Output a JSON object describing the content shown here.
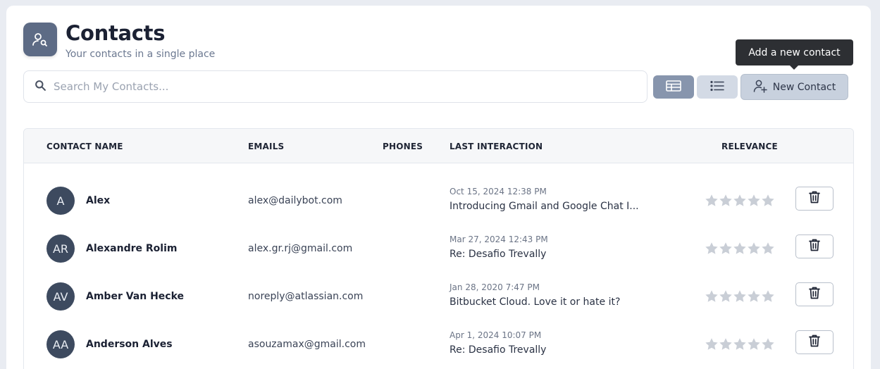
{
  "header": {
    "icon": "contact-search-icon",
    "title": "Contacts",
    "subtitle": "Your contacts in a single place"
  },
  "search": {
    "placeholder": "Search My Contacts...",
    "value": "",
    "icon": "search-icon"
  },
  "toolbar": {
    "table_view_icon": "table-view-icon",
    "list_view_icon": "list-view-icon",
    "new_contact_label": "New Contact",
    "new_contact_icon": "add-user-icon",
    "tooltip": "Add a new contact"
  },
  "table": {
    "columns": [
      "CONTACT NAME",
      "EMAILS",
      "PHONES",
      "LAST INTERACTION",
      "RELEVANCE"
    ],
    "rows": [
      {
        "initials": "A",
        "name": "Alex",
        "email": "alex@dailybot.com",
        "phone": "",
        "date": "Oct 15, 2024 12:38 PM",
        "subject": "Introducing Gmail and Google Chat I...",
        "relevance": 0
      },
      {
        "initials": "AR",
        "name": "Alexandre Rolim",
        "email": "alex.gr.rj@gmail.com",
        "phone": "",
        "date": "Mar 27, 2024 12:43 PM",
        "subject": "Re: Desafio Trevally",
        "relevance": 0
      },
      {
        "initials": "AV",
        "name": "Amber Van Hecke",
        "email": "noreply@atlassian.com",
        "phone": "",
        "date": "Jan 28, 2020 7:47 PM",
        "subject": "Bitbucket Cloud. Love it or hate it?",
        "relevance": 0
      },
      {
        "initials": "AA",
        "name": "Anderson Alves",
        "email": "asouzamax@gmail.com",
        "phone": "",
        "date": "Apr 1, 2024 10:07 PM",
        "subject": "Re: Desafio Trevally",
        "relevance": 0
      }
    ]
  },
  "colors": {
    "accent": "#5d6b85",
    "avatar": "#3d4a5f",
    "star_empty": "#c9ced6"
  }
}
